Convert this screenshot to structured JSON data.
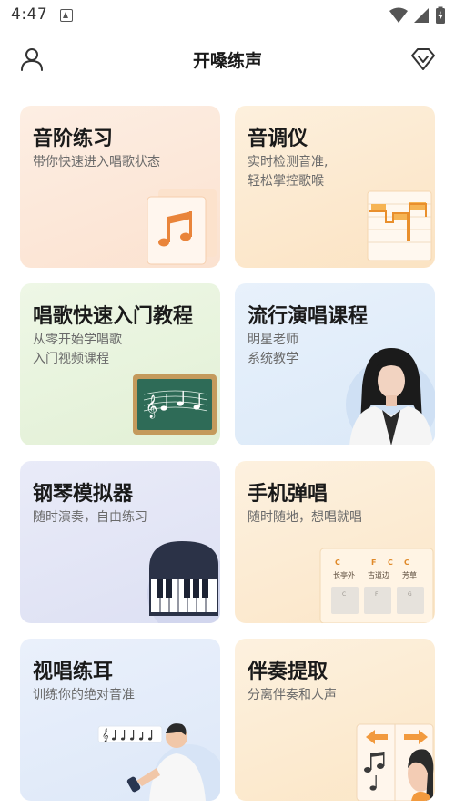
{
  "status_bar": {
    "time": "4:47"
  },
  "header": {
    "title": "开嗓练声"
  },
  "cards": [
    {
      "title": "音阶练习",
      "subtitle_lines": [
        "带你快速进入唱歌状态"
      ]
    },
    {
      "title": "音调仪",
      "subtitle_lines": [
        "实时检测音准,",
        "轻松掌控歌喉"
      ]
    },
    {
      "title": "唱歌快速入门教程",
      "subtitle_lines": [
        "从零开始学唱歌",
        "入门视频课程"
      ]
    },
    {
      "title": "流行演唱课程",
      "subtitle_lines": [
        "明星老师",
        "系统教学"
      ]
    },
    {
      "title": "钢琴模拟器",
      "subtitle_lines": [
        "随时演奏，自由练习"
      ]
    },
    {
      "title": "手机弹唱",
      "subtitle_lines": [
        "随时随地，想唱就唱"
      ]
    },
    {
      "title": "视唱练耳",
      "subtitle_lines": [
        "训练你的绝对音准"
      ]
    },
    {
      "title": "伴奏提取",
      "subtitle_lines": [
        "分离伴奏和人声"
      ]
    }
  ],
  "strum_sheet": {
    "chords": [
      "C",
      "F",
      "C",
      "C"
    ],
    "lyrics": [
      "长亭外",
      "古道边",
      "芳草"
    ],
    "keys": [
      "C",
      "F",
      "G"
    ]
  },
  "colors": {
    "accent": "#f29a3e",
    "text": "#1a1a1a",
    "subtext": "#6a6a6a"
  }
}
